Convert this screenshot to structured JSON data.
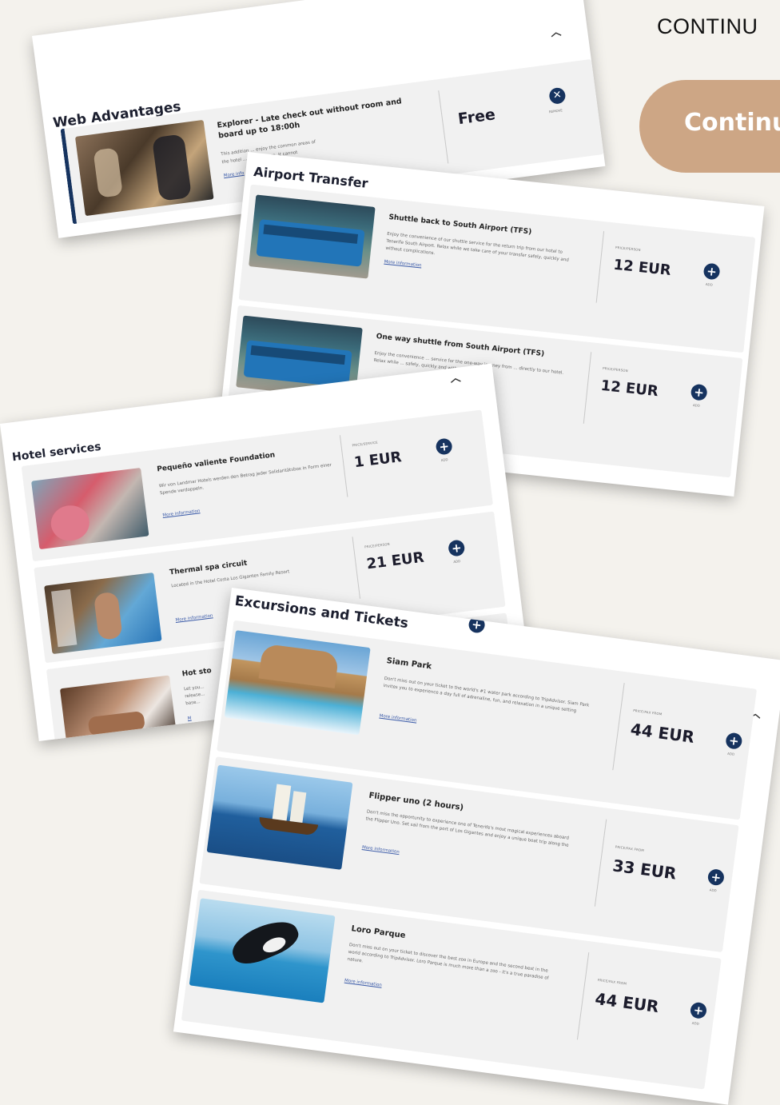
{
  "header": {
    "continue_heading": "CONTINU",
    "continue_button": "Continu"
  },
  "colors": {
    "navy": "#16335f",
    "button": "#cda685",
    "bg": "#f4f2ed"
  },
  "web_advantages": {
    "title": "Web Advantages",
    "item": {
      "title_line1": "Explorer - Late check out without room and",
      "title_line2": "board up to 18:00h",
      "desc_line1": "This addition ... enjoy the common areas of",
      "desc_line2": "the hotel ... of departure. It cannot",
      "more": "More info",
      "price": "Free",
      "action": "REMOVE",
      "icon": "close-icon"
    }
  },
  "airport_transfer": {
    "title": "Airport Transfer",
    "items": [
      {
        "title": "Shuttle back to South Airport (TFS)",
        "desc": "Enjoy the convenience of our shuttle service for the return trip from our hotel to Tenerife South Airport. Relax while we take care of your transfer safely, quickly and without complications.",
        "more": "More information",
        "price_label": "PRICE/PERSON",
        "price": "12 EUR",
        "action": "ADD"
      },
      {
        "title": "One way shuttle from South Airport (TFS)",
        "desc": "Enjoy the convenience ... service for the one-way journey from ... directly to our hotel. Relax while ... safely, quickly and without",
        "more": "",
        "price_label": "PRICE/PERSON",
        "price": "12 EUR",
        "action": "ADD"
      }
    ]
  },
  "hotel_services": {
    "title": "Hotel services",
    "items": [
      {
        "title": "Pequeño valiente Foundation",
        "desc": "Wir von Landmar Hotels werden den Betrag jeder Solidaritätsbox in Form einer Spende verdoppeln.",
        "more": "More information",
        "price_label": "PRICE/SERVICE",
        "price": "1 EUR",
        "action": "ADD"
      },
      {
        "title": "Thermal spa circuit",
        "desc": "Located in the Hotel Costa Los Gigantes Family Resort",
        "more": "More information",
        "price_label": "PRICE/PERSON",
        "price": "21 EUR",
        "action": "ADD"
      },
      {
        "title": "Hot sto",
        "desc": "Let you... release... base...",
        "more": "M"
      }
    ]
  },
  "excursions": {
    "title": "Excursions and Tickets",
    "items": [
      {
        "title": "Siam Park",
        "desc": "Don't miss out on your ticket to the world's #1 water park according to TripAdvisor. Siam Park invites you to experience a day full of adrenaline, fun, and relaxation in a unique setting",
        "more": "More information",
        "price_label": "PRICE/PAX FROM",
        "price": "44 EUR",
        "action": "ADD"
      },
      {
        "title": "Flipper uno (2 hours)",
        "desc": "Don't miss the opportunity to experience one of Tenerife's most magical experiences aboard the Flipper Uno. Set sail from the port of Los Gigantes and enjoy a unique boat trip along the",
        "more": "More information",
        "price_label": "PRICE/PAX FROM",
        "price": "33 EUR",
        "action": "ADD"
      },
      {
        "title": "Loro Parque",
        "desc": "Don't miss out on your ticket to discover the best zoo in Europe and the second best in the world according to TripAdvisor. Loro Parque is much more than a zoo - it's a true paradise of nature.",
        "more": "More information",
        "price_label": "PRICE/PAX FROM",
        "price": "44 EUR",
        "action": "ADD"
      }
    ]
  },
  "icons": {
    "chevron": "chevron-up-icon",
    "add": "plus-circle-icon",
    "remove": "close-icon"
  }
}
